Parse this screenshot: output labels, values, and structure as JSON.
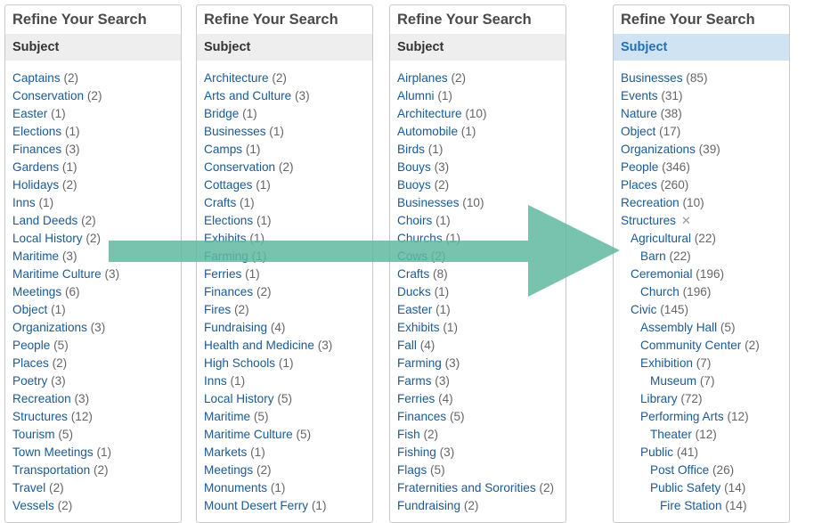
{
  "panels": [
    {
      "title": "Refine Your Search",
      "subject": "Subject",
      "items": [
        {
          "label": "Captains",
          "count": "(2)"
        },
        {
          "label": "Conservation",
          "count": "(2)"
        },
        {
          "label": "Easter",
          "count": "(1)"
        },
        {
          "label": "Elections",
          "count": "(1)"
        },
        {
          "label": "Finances",
          "count": "(3)"
        },
        {
          "label": "Gardens",
          "count": "(1)"
        },
        {
          "label": "Holidays",
          "count": "(2)"
        },
        {
          "label": "Inns",
          "count": "(1)"
        },
        {
          "label": "Land Deeds",
          "count": "(2)"
        },
        {
          "label": "Local History",
          "count": "(2)"
        },
        {
          "label": "Maritime",
          "count": "(3)"
        },
        {
          "label": "Maritime Culture",
          "count": "(3)"
        },
        {
          "label": "Meetings",
          "count": "(6)"
        },
        {
          "label": "Object",
          "count": "(1)"
        },
        {
          "label": "Organizations",
          "count": "(3)"
        },
        {
          "label": "People",
          "count": "(5)"
        },
        {
          "label": "Places",
          "count": "(2)"
        },
        {
          "label": "Poetry",
          "count": "(3)"
        },
        {
          "label": "Recreation",
          "count": "(3)"
        },
        {
          "label": "Structures",
          "count": "(12)"
        },
        {
          "label": "Tourism",
          "count": "(5)"
        },
        {
          "label": "Town Meetings",
          "count": "(1)"
        },
        {
          "label": "Transportation",
          "count": "(2)"
        },
        {
          "label": "Travel",
          "count": "(2)"
        },
        {
          "label": "Vessels",
          "count": "(2)"
        }
      ]
    },
    {
      "title": "Refine Your Search",
      "subject": "Subject",
      "items": [
        {
          "label": "Architecture",
          "count": "(2)"
        },
        {
          "label": "Arts and Culture",
          "count": "(3)"
        },
        {
          "label": "Bridge",
          "count": "(1)"
        },
        {
          "label": "Businesses",
          "count": "(1)"
        },
        {
          "label": "Camps",
          "count": "(1)"
        },
        {
          "label": "Conservation",
          "count": "(2)"
        },
        {
          "label": "Cottages",
          "count": "(1)"
        },
        {
          "label": "Crafts",
          "count": "(1)"
        },
        {
          "label": "Elections",
          "count": "(1)"
        },
        {
          "label": "Exhibits",
          "count": "(1)"
        },
        {
          "label": "Farming",
          "count": "(1)"
        },
        {
          "label": "Ferries",
          "count": "(1)"
        },
        {
          "label": "Finances",
          "count": "(2)"
        },
        {
          "label": "Fires",
          "count": "(2)"
        },
        {
          "label": "Fundraising",
          "count": "(4)"
        },
        {
          "label": "Health and Medicine",
          "count": "(3)"
        },
        {
          "label": "High Schools",
          "count": "(1)"
        },
        {
          "label": "Inns",
          "count": "(1)"
        },
        {
          "label": "Local History",
          "count": "(5)"
        },
        {
          "label": "Maritime",
          "count": "(5)"
        },
        {
          "label": "Maritime Culture",
          "count": "(5)"
        },
        {
          "label": "Markets",
          "count": "(1)"
        },
        {
          "label": "Meetings",
          "count": "(2)"
        },
        {
          "label": "Monuments",
          "count": "(1)"
        },
        {
          "label": "Mount Desert Ferry",
          "count": "(1)"
        }
      ]
    },
    {
      "title": "Refine Your Search",
      "subject": "Subject",
      "items": [
        {
          "label": "Airplanes",
          "count": "(2)"
        },
        {
          "label": "Alumni",
          "count": "(1)"
        },
        {
          "label": "Architecture",
          "count": "(10)"
        },
        {
          "label": "Automobile",
          "count": "(1)"
        },
        {
          "label": "Birds",
          "count": "(1)"
        },
        {
          "label": "Bouys",
          "count": "(3)"
        },
        {
          "label": "Buoys",
          "count": "(2)"
        },
        {
          "label": "Businesses",
          "count": "(10)"
        },
        {
          "label": "Choirs",
          "count": "(1)"
        },
        {
          "label": "Churchs",
          "count": "(1)"
        },
        {
          "label": "Cows",
          "count": "(2)"
        },
        {
          "label": "Crafts",
          "count": "(8)"
        },
        {
          "label": "Ducks",
          "count": "(1)"
        },
        {
          "label": "Easter",
          "count": "(1)"
        },
        {
          "label": "Exhibits",
          "count": "(1)"
        },
        {
          "label": "Fall",
          "count": "(4)"
        },
        {
          "label": "Farming",
          "count": "(3)"
        },
        {
          "label": "Farms",
          "count": "(3)"
        },
        {
          "label": "Ferries",
          "count": "(4)"
        },
        {
          "label": "Finances",
          "count": "(5)"
        },
        {
          "label": "Fish",
          "count": "(2)"
        },
        {
          "label": "Fishing",
          "count": "(3)"
        },
        {
          "label": "Flags",
          "count": "(5)"
        },
        {
          "label": "Fraternities and Sororities",
          "count": "(2)"
        },
        {
          "label": "Fundraising",
          "count": "(2)"
        }
      ]
    },
    {
      "title": "Refine Your Search",
      "subject": "Subject",
      "remove_glyph": "✕",
      "items": [
        {
          "label": "Businesses",
          "count": "(85)",
          "level": 0
        },
        {
          "label": "Events",
          "count": "(31)",
          "level": 0
        },
        {
          "label": "Nature",
          "count": "(38)",
          "level": 0
        },
        {
          "label": "Object",
          "count": "(17)",
          "level": 0
        },
        {
          "label": "Organizations",
          "count": "(39)",
          "level": 0
        },
        {
          "label": "People",
          "count": "(346)",
          "level": 0
        },
        {
          "label": "Places",
          "count": "(260)",
          "level": 0
        },
        {
          "label": "Recreation",
          "count": "(10)",
          "level": 0
        },
        {
          "label": "Structures",
          "count": "",
          "level": 0,
          "selected": true
        },
        {
          "label": "Agricultural",
          "count": "(22)",
          "level": 1
        },
        {
          "label": "Barn",
          "count": "(22)",
          "level": 2
        },
        {
          "label": "Ceremonial",
          "count": "(196)",
          "level": 1
        },
        {
          "label": "Church",
          "count": "(196)",
          "level": 2
        },
        {
          "label": "Civic",
          "count": "(145)",
          "level": 1
        },
        {
          "label": "Assembly Hall",
          "count": "(5)",
          "level": 2
        },
        {
          "label": "Community Center",
          "count": "(2)",
          "level": 2
        },
        {
          "label": "Exhibition",
          "count": "(7)",
          "level": 2
        },
        {
          "label": "Museum",
          "count": "(7)",
          "level": 3
        },
        {
          "label": "Library",
          "count": "(72)",
          "level": 2
        },
        {
          "label": "Performing Arts",
          "count": "(12)",
          "level": 2
        },
        {
          "label": "Theater",
          "count": "(12)",
          "level": 3
        },
        {
          "label": "Public",
          "count": "(41)",
          "level": 2
        },
        {
          "label": "Post Office",
          "count": "(26)",
          "level": 3
        },
        {
          "label": "Public Safety",
          "count": "(14)",
          "level": 3
        },
        {
          "label": "Fire Station",
          "count": "(14)",
          "level": 4
        }
      ]
    }
  ],
  "colors": {
    "link": "#1a5a96",
    "arrow": "#5fb8a0",
    "active_subject_bg": "#cfe3f2"
  },
  "icons": {
    "arrow": "right-arrow-overlay"
  }
}
